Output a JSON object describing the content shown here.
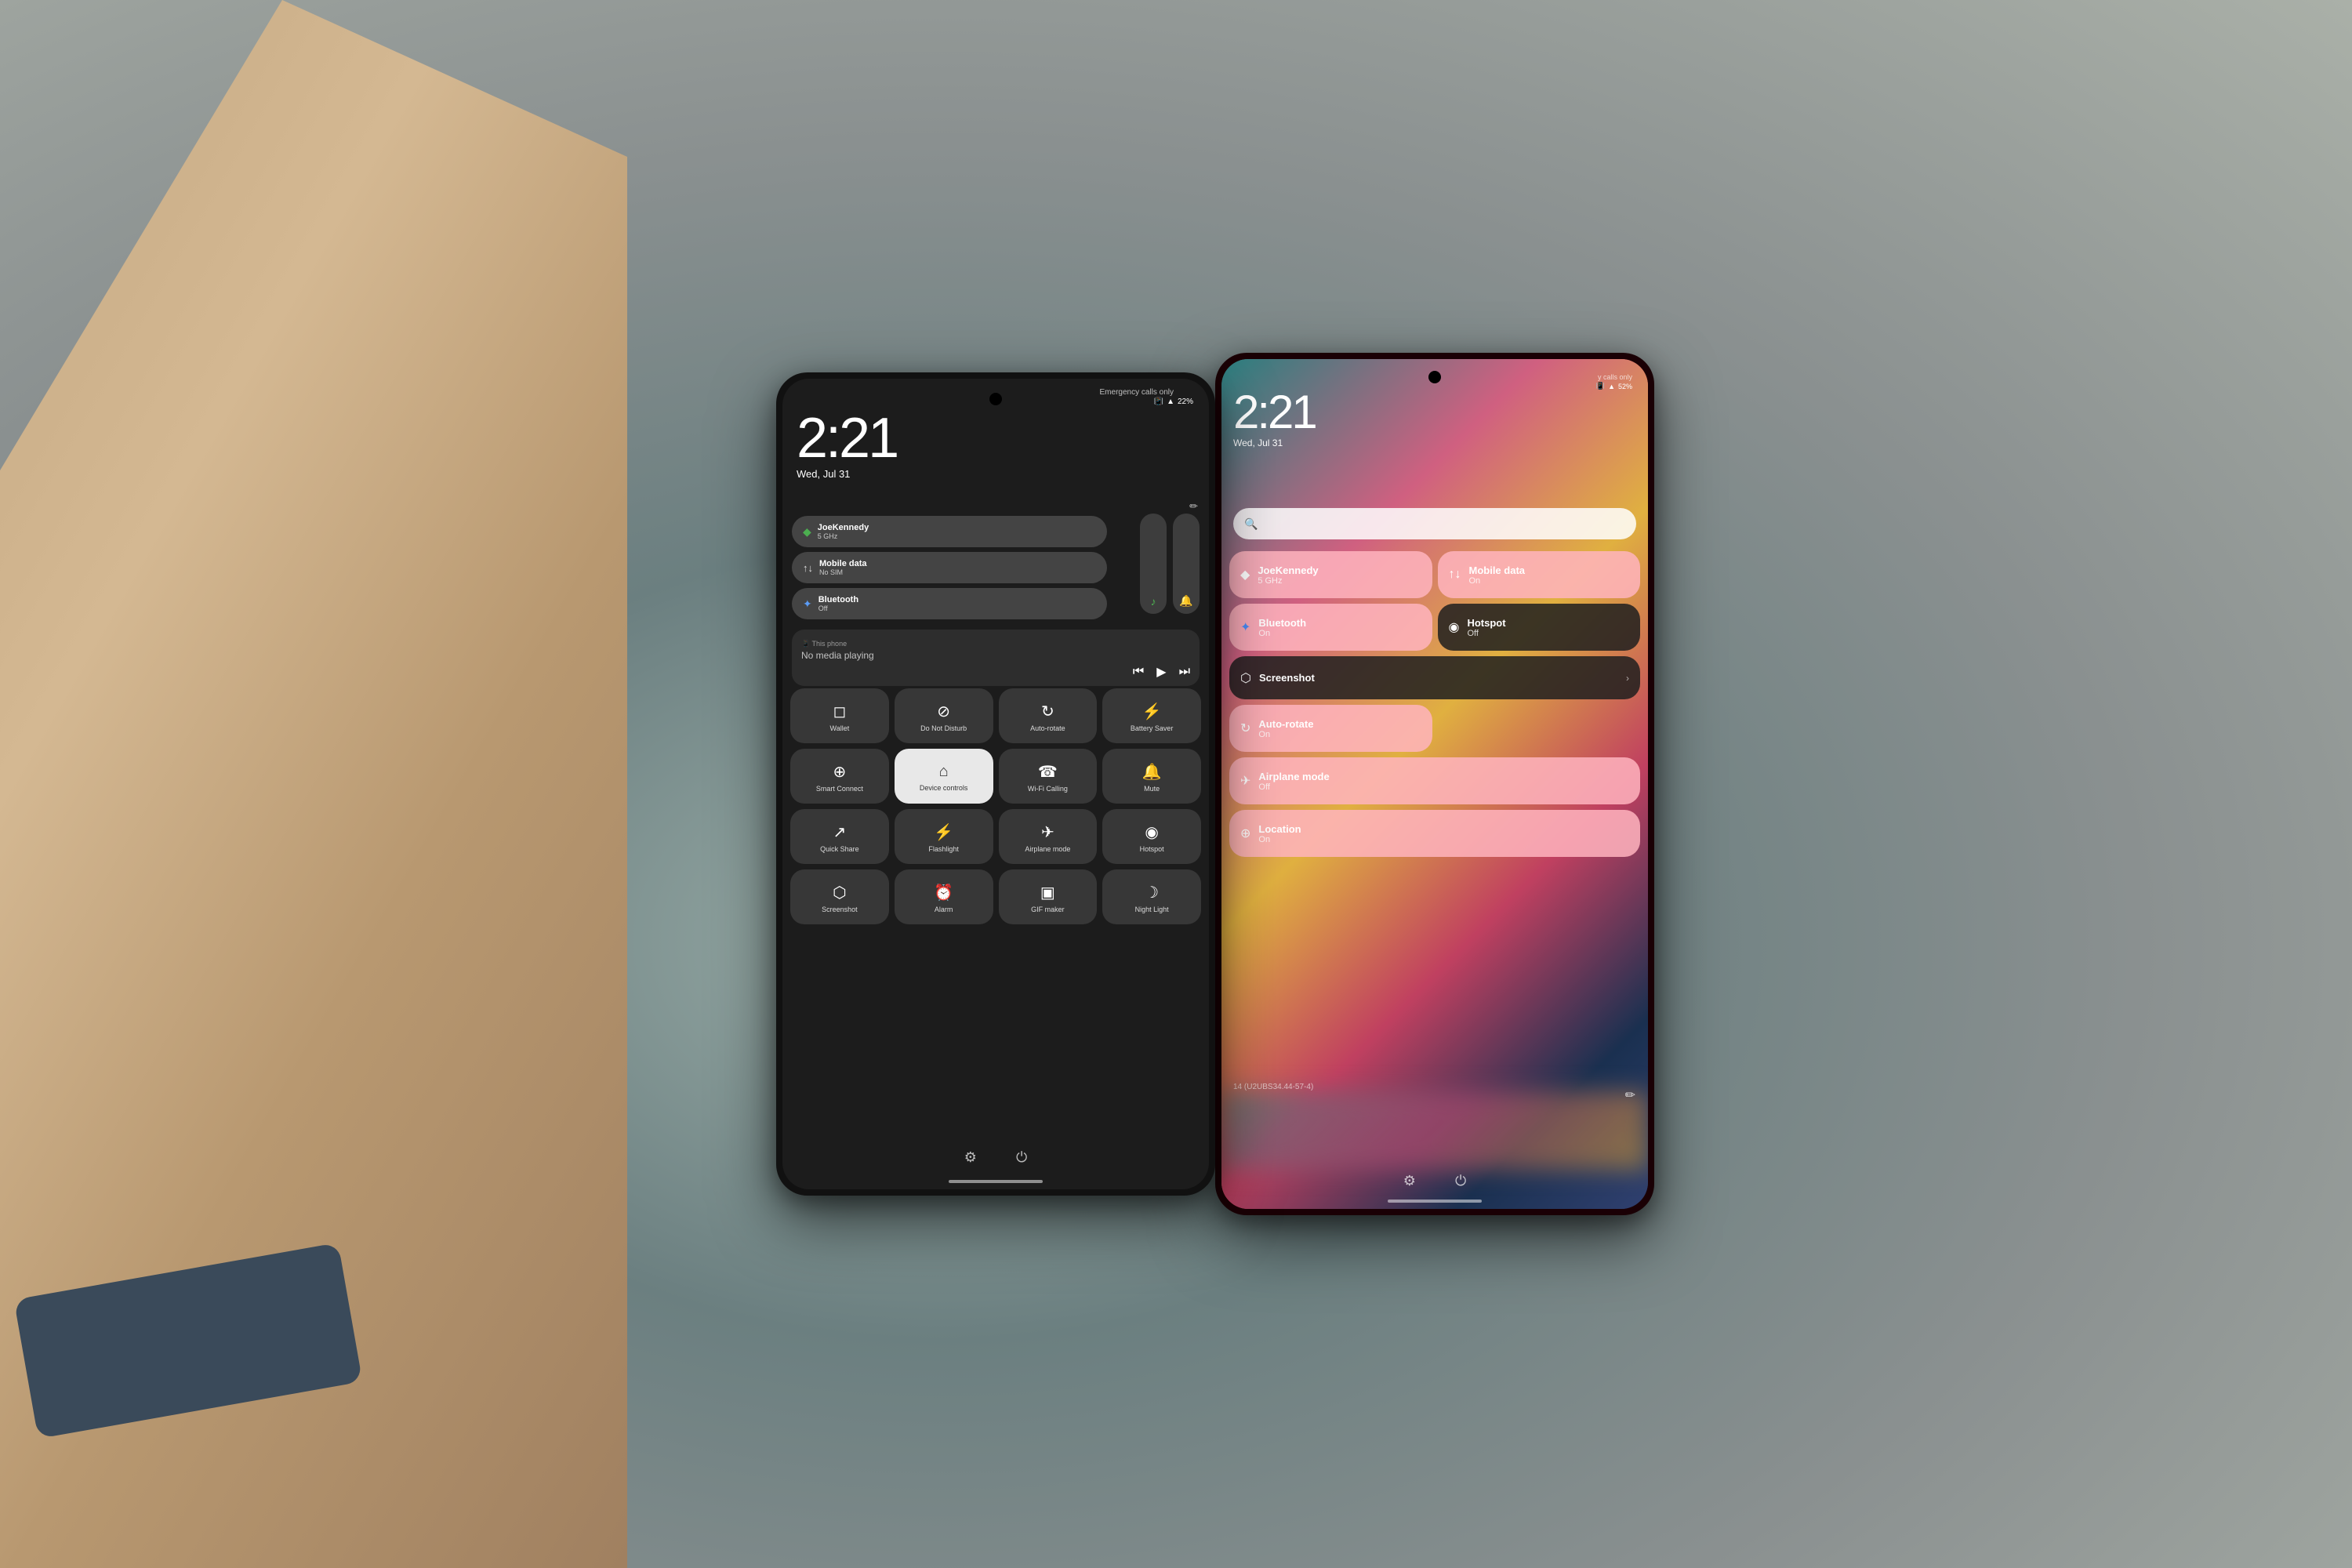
{
  "scene": {
    "bg_color": "#7a8a8a"
  },
  "left_phone": {
    "time": "2:21",
    "date": "Wed, Jul 31",
    "emergency_text": "Emergency calls only",
    "battery": "22%",
    "edit_icon": "✏",
    "network_tiles": [
      {
        "icon": "◆",
        "title": "JoeKennedy",
        "subtitle": "5 GHz",
        "active": true
      },
      {
        "icon": "↑↓",
        "title": "Mobile data",
        "subtitle": "No SIM",
        "active": false
      },
      {
        "icon": "✦",
        "title": "Bluetooth",
        "subtitle": "Off",
        "active": false
      }
    ],
    "media": {
      "no_playing": "No media playing",
      "phone_label": "This phone"
    },
    "qs_tiles": [
      {
        "icon": "◻",
        "label": "Wallet",
        "active": false
      },
      {
        "icon": "⊘",
        "label": "Do Not Disturb",
        "active": false
      },
      {
        "icon": "↻",
        "label": "Auto-rotate",
        "active": false
      },
      {
        "icon": "⚡",
        "label": "Battery Saver",
        "active": false
      },
      {
        "icon": "⊕",
        "label": "Smart Connect",
        "active": false
      },
      {
        "icon": "⌂",
        "label": "Device controls",
        "active": true
      },
      {
        "icon": "☎",
        "label": "Wi-Fi Calling",
        "active": false
      },
      {
        "icon": "🔔",
        "label": "Mute",
        "active": false
      },
      {
        "icon": "↗",
        "label": "Quick Share",
        "active": false
      },
      {
        "icon": "⚡",
        "label": "Flashlight",
        "active": false
      },
      {
        "icon": "✈",
        "label": "Airplane mode",
        "active": false
      },
      {
        "icon": "◉",
        "label": "Hotspot",
        "active": false
      },
      {
        "icon": "⬡",
        "label": "Screenshot",
        "active": false
      },
      {
        "icon": "⏰",
        "label": "Alarm",
        "active": false
      },
      {
        "icon": "▣",
        "label": "GIF maker",
        "active": false
      },
      {
        "icon": "☽",
        "label": "Night Light",
        "active": false
      }
    ],
    "bottom": {
      "settings_icon": "⚙",
      "power_icon": "⏻"
    }
  },
  "right_phone": {
    "time": "2:21",
    "date": "Wed, Jul 31",
    "calls_only": "calls only",
    "battery": "52%",
    "tiles": [
      {
        "icon": "◆",
        "title": "JoeKennedy",
        "subtitle": "5 GHz",
        "type": "pink"
      },
      {
        "icon": "↑↓",
        "title": "Mobile data",
        "subtitle": "On",
        "type": "pink"
      },
      {
        "icon": "✦",
        "title": "Bluetooth",
        "subtitle": "On",
        "type": "pink"
      },
      {
        "icon": "◉",
        "title": "Hotspot",
        "subtitle": "Off",
        "type": "dark"
      },
      {
        "icon": "⬡",
        "title": "Screenshot",
        "subtitle": "",
        "type": "dark",
        "wide": true
      },
      {
        "icon": "↻",
        "title": "Auto-rotate",
        "subtitle": "On",
        "type": "pink"
      },
      {
        "icon": "✈",
        "title": "Airplane mode",
        "subtitle": "Off",
        "type": "pink"
      },
      {
        "icon": "⊕",
        "title": "Location",
        "subtitle": "On",
        "type": "pink"
      }
    ],
    "version": "14 (U2UBS34.44-57-4)",
    "edit_icon": "✏",
    "bottom": {
      "settings_icon": "⚙",
      "power_icon": "⏻"
    }
  }
}
